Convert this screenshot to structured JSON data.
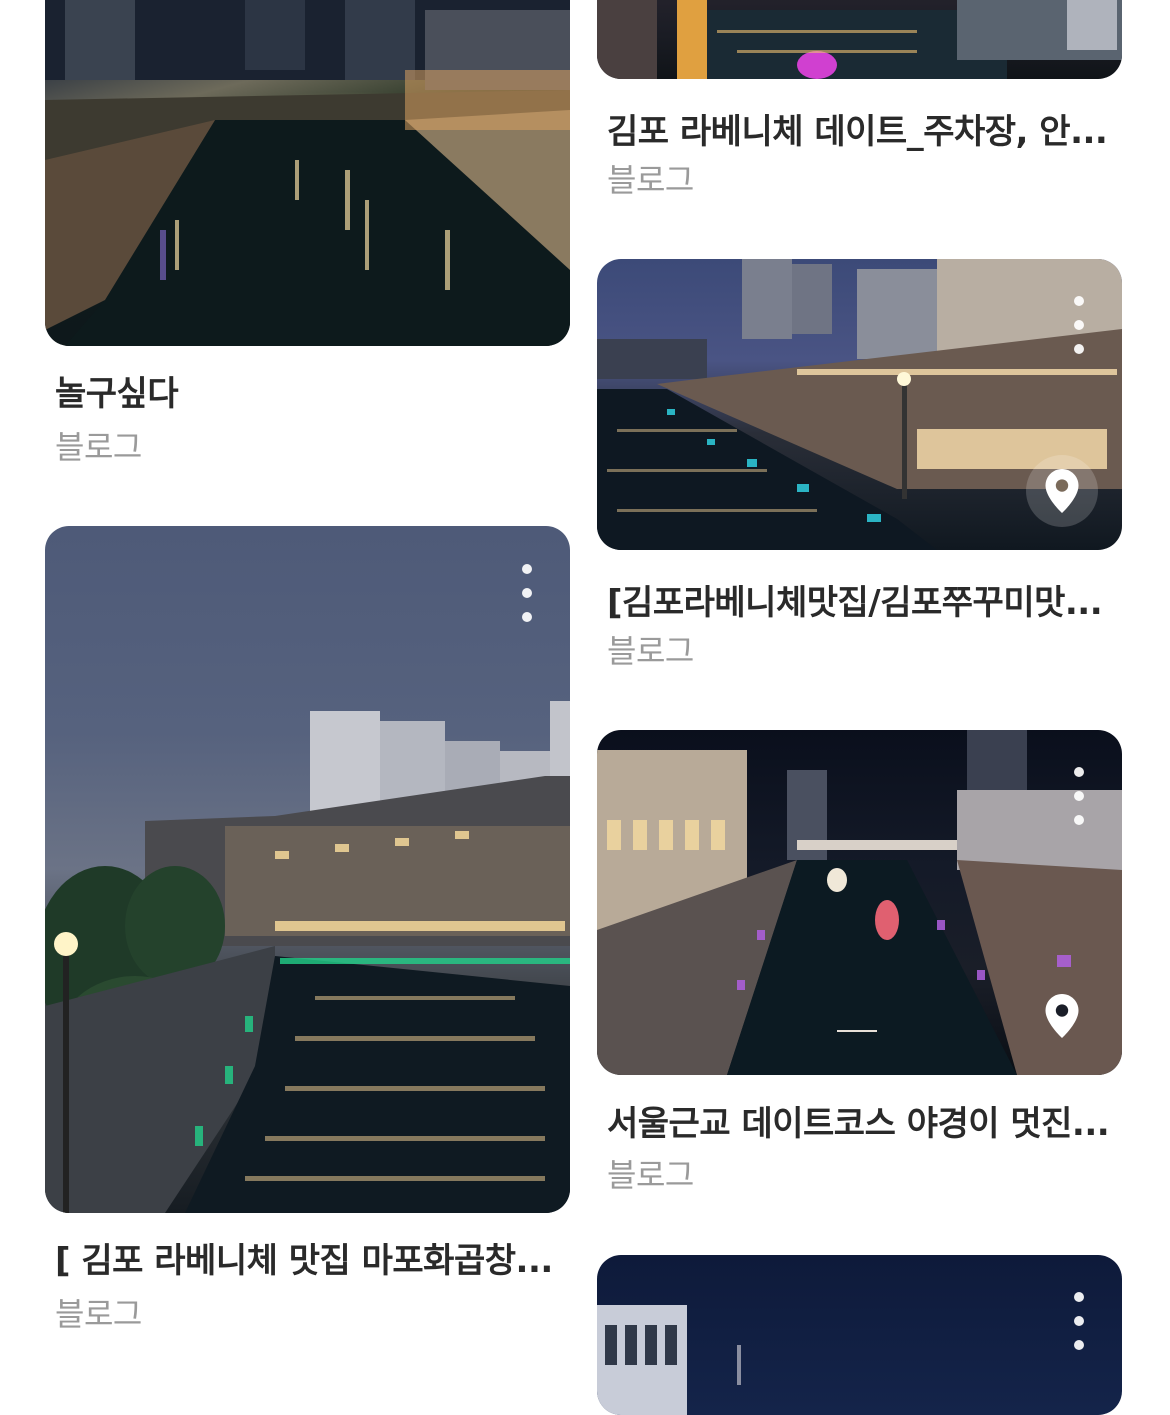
{
  "results": [
    {
      "title": "놀구싶다",
      "source": "블로그"
    },
    {
      "title": "[ 김포 라베니체 맛집 마포화곱창...",
      "source": "블로그"
    },
    {
      "title": "김포 라베니체 데이트_주차장, 안...",
      "source": "블로그"
    },
    {
      "title": "[김포라베니체맛집/김포쭈꾸미맛...",
      "source": "블로그"
    },
    {
      "title": "서울근교 데이트코스 야경이 멋진...",
      "source": "블로그"
    }
  ],
  "icons": {
    "more": "more-vertical-icon",
    "location": "location-pin-icon"
  }
}
